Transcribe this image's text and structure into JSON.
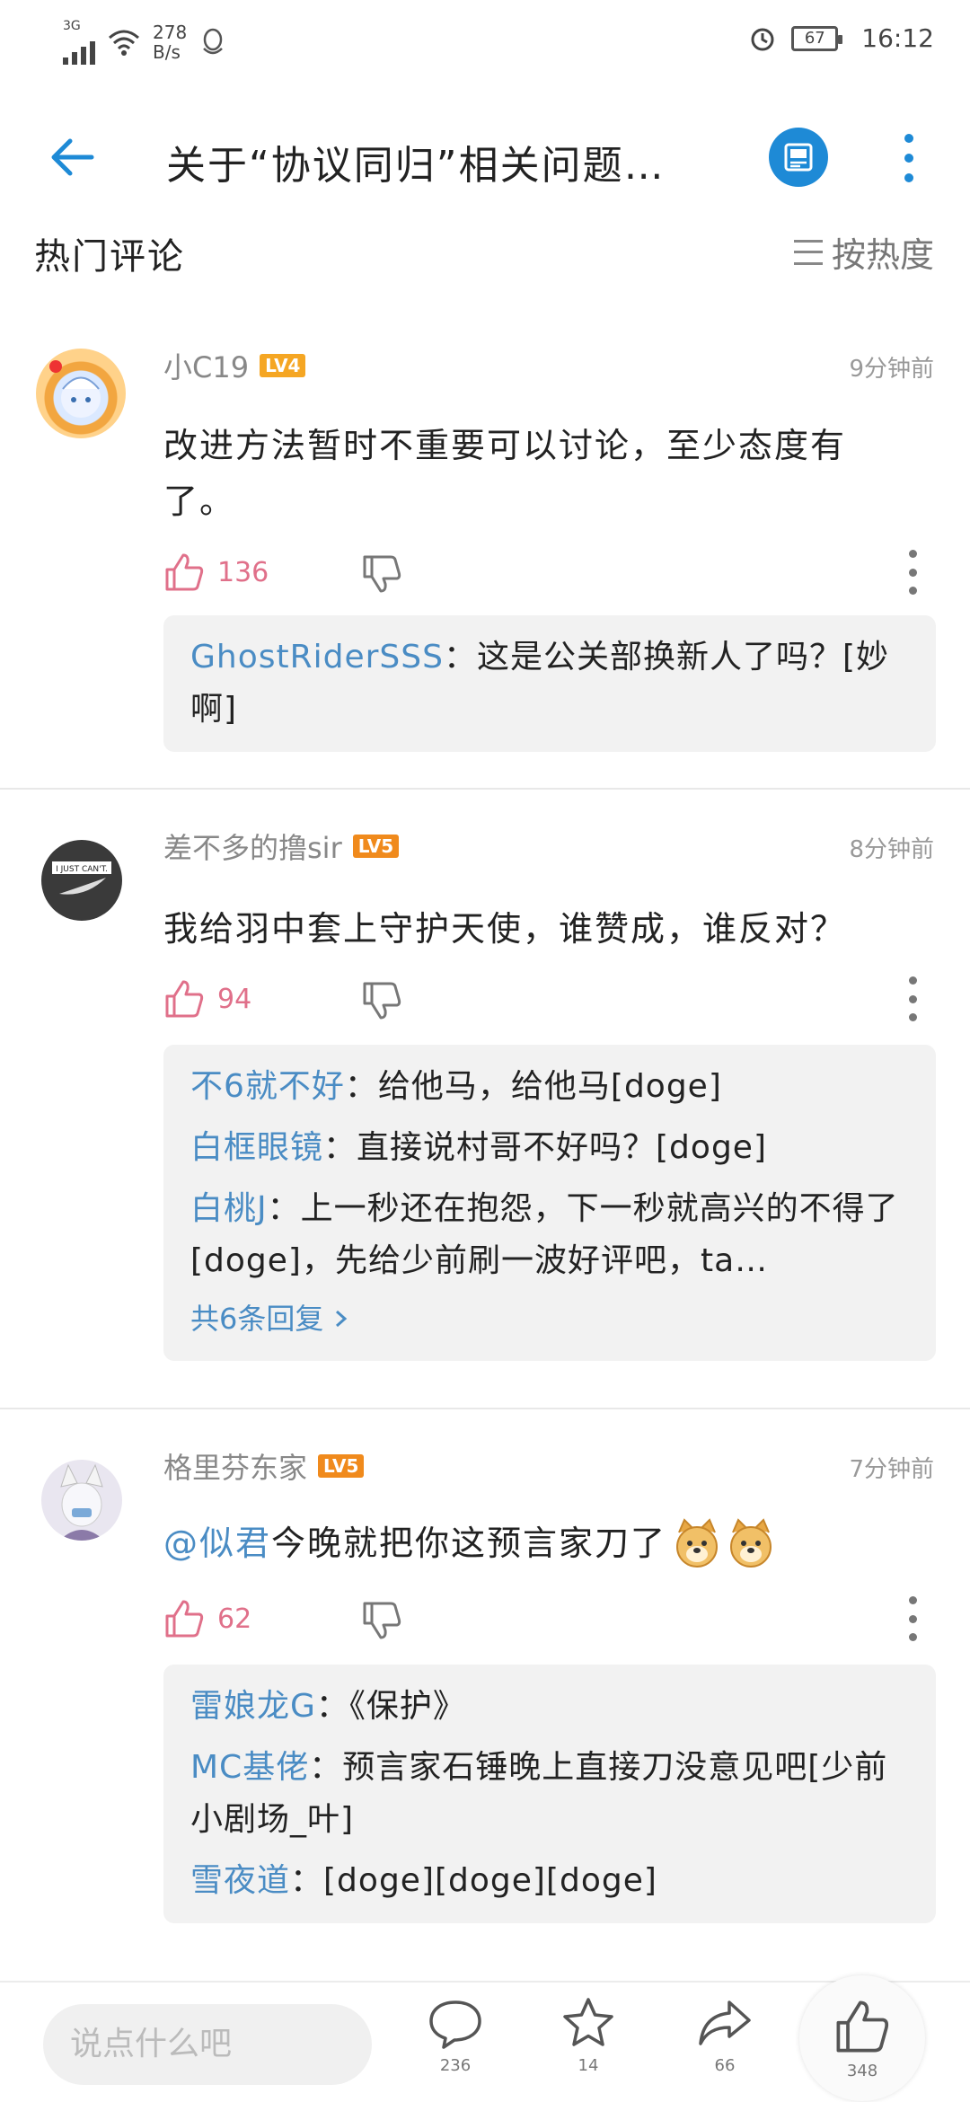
{
  "status_bar": {
    "net_type": "3G",
    "net_speed_value": "278",
    "net_speed_unit": "B/s",
    "battery": "67",
    "time": "16:12"
  },
  "header": {
    "title": "关于“协议同归”相关问题…"
  },
  "section": {
    "title": "热门评论",
    "sort_label": "按热度"
  },
  "comments": [
    {
      "user": "小C19",
      "level": "LV4",
      "level_color": "#f5a623",
      "time": "9分钟前",
      "text": "改进方法暂时不重要可以讨论，至少态度有了。",
      "likes": "136",
      "replies": [
        {
          "name": "GhostRiderSSS",
          "text": "：这是公关部换新人了吗？[妙啊]"
        }
      ]
    },
    {
      "user": "差不多的撸sir",
      "level": "LV5",
      "level_color": "#f08a1c",
      "time": "8分钟前",
      "text": "我给羽中套上守护天使，谁赞成，谁反对？",
      "likes": "94",
      "replies": [
        {
          "name": "不6就不好",
          "text": "：给他马，给他马[doge]"
        },
        {
          "name": "白框眼镜",
          "text": "：直接说村哥不好吗？[doge]"
        },
        {
          "name": "白桃J",
          "text": "：上一秒还在抱怨，下一秒就高兴的不得了[doge]，先给少前刷一波好评吧，ta…"
        }
      ],
      "more_replies": "共6条回复"
    },
    {
      "user": "格里芬东家",
      "level": "LV5",
      "level_color": "#f08a1c",
      "time": "7分钟前",
      "mention": "@似君",
      "text": " 今晚就把你这预言家刀了",
      "emoji_names": [
        "doge-emoji",
        "doge-emoji"
      ],
      "likes": "62",
      "replies": [
        {
          "name": "雷娘龙G",
          "text": "：《保护》"
        },
        {
          "name": "MC基佬",
          "text": "：预言家石锤晚上直接刀没意见吧[少前小剧场_叶]"
        },
        {
          "name": "雪夜道",
          "text": "：[doge][doge][doge]"
        }
      ]
    }
  ],
  "bottom_bar": {
    "input_placeholder": "说点什么吧",
    "comment_count": "236",
    "favorite_count": "14",
    "share_count": "66",
    "like_count": "348"
  },
  "colors": {
    "accent": "#1e8ad6",
    "reply_name": "#4a8cc4",
    "like": "#e0708a"
  }
}
